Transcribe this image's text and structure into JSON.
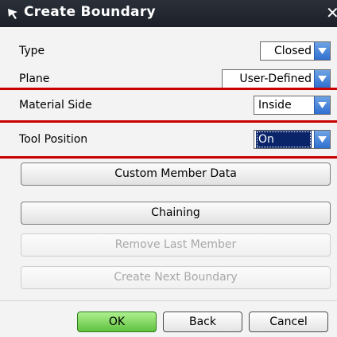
{
  "dialog": {
    "title": "Create Boundary",
    "close_glyph": "✕"
  },
  "fields": {
    "type": {
      "label": "Type",
      "value": "Closed"
    },
    "plane": {
      "label": "Plane",
      "value": "User-Defined"
    },
    "material_side": {
      "label": "Material Side",
      "value": "Inside"
    },
    "tool_position": {
      "label": "Tool Position",
      "value": "On"
    }
  },
  "buttons": {
    "custom_member_data": "Custom Member Data",
    "chaining": "Chaining",
    "remove_last_member": "Remove Last Member",
    "create_next_boundary": "Create Next Boundary",
    "ok": "OK",
    "back": "Back",
    "cancel": "Cancel"
  },
  "colors": {
    "title_bar": "#1f242c",
    "section_divider": "#c80000",
    "combo_arrow": "#3f7fd8",
    "selected_highlight": "#0a246a",
    "ok_button": "#7ed85a"
  },
  "icons": {
    "title": "arrow-cursor-icon",
    "combo": "chevron-down-icon"
  }
}
